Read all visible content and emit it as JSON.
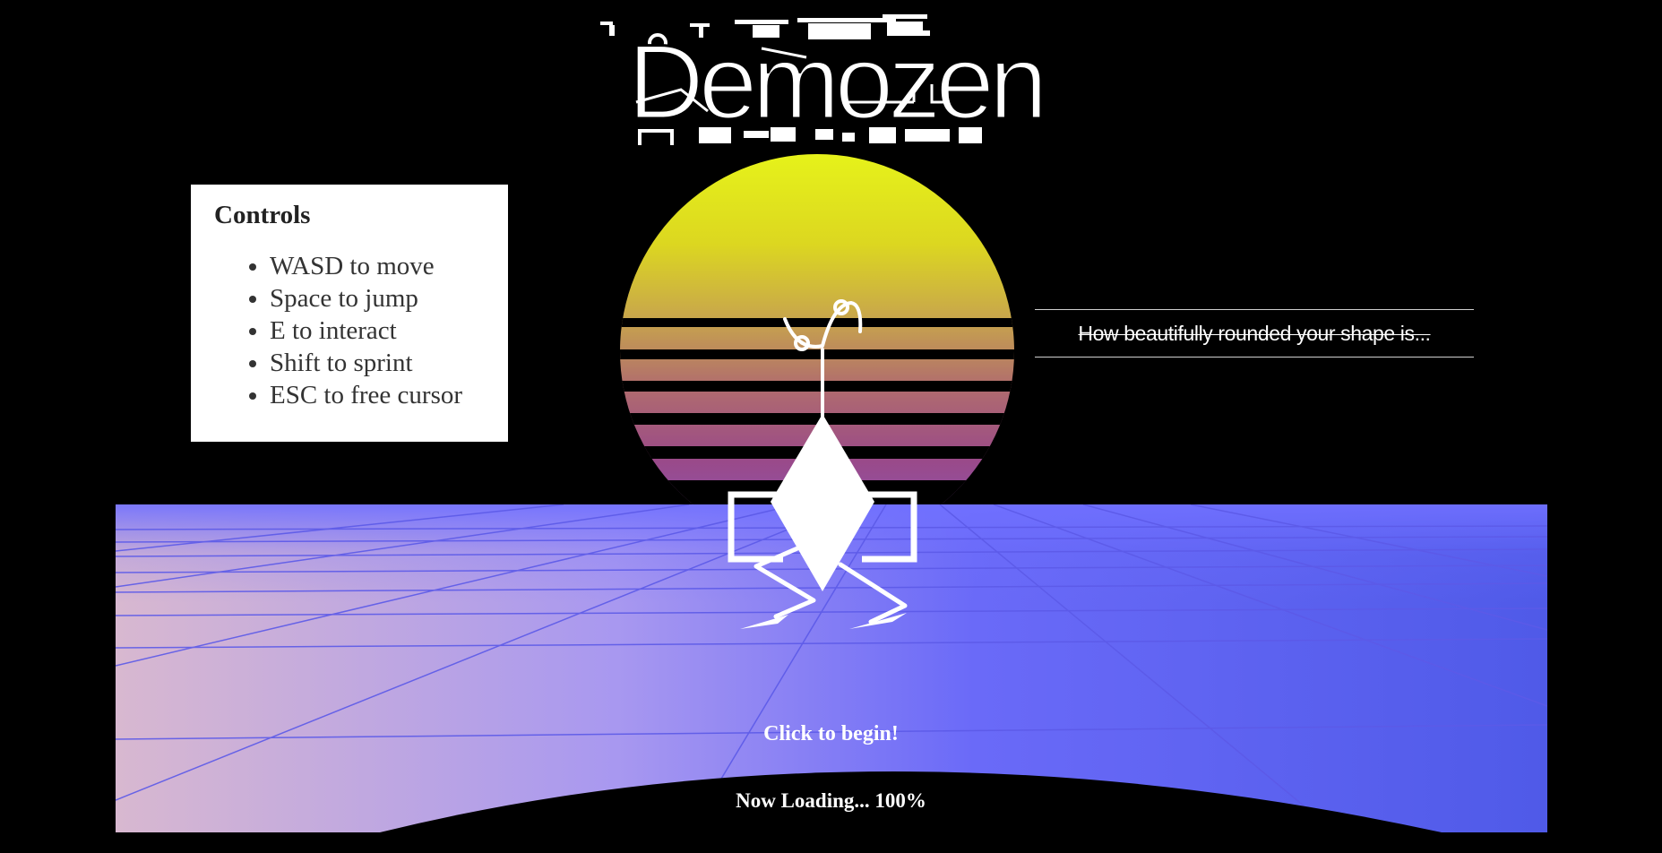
{
  "title": "Demozen",
  "controls": {
    "heading": "Controls",
    "items": [
      "WASD to move",
      "Space to jump",
      "E to interact",
      "Shift to sprint",
      "ESC to free cursor"
    ]
  },
  "quote": "How beautifully rounded your shape is...",
  "status": {
    "click_prompt": "Click to begin!",
    "loading_text": "Now Loading... 100%"
  },
  "colors": {
    "sun_top": "#e6f21a",
    "sun_bottom": "#8f4fa8",
    "ground_left": "#d8b8d0",
    "ground_right": "#4f5ae8",
    "grid_line": "#5c5ae8"
  }
}
